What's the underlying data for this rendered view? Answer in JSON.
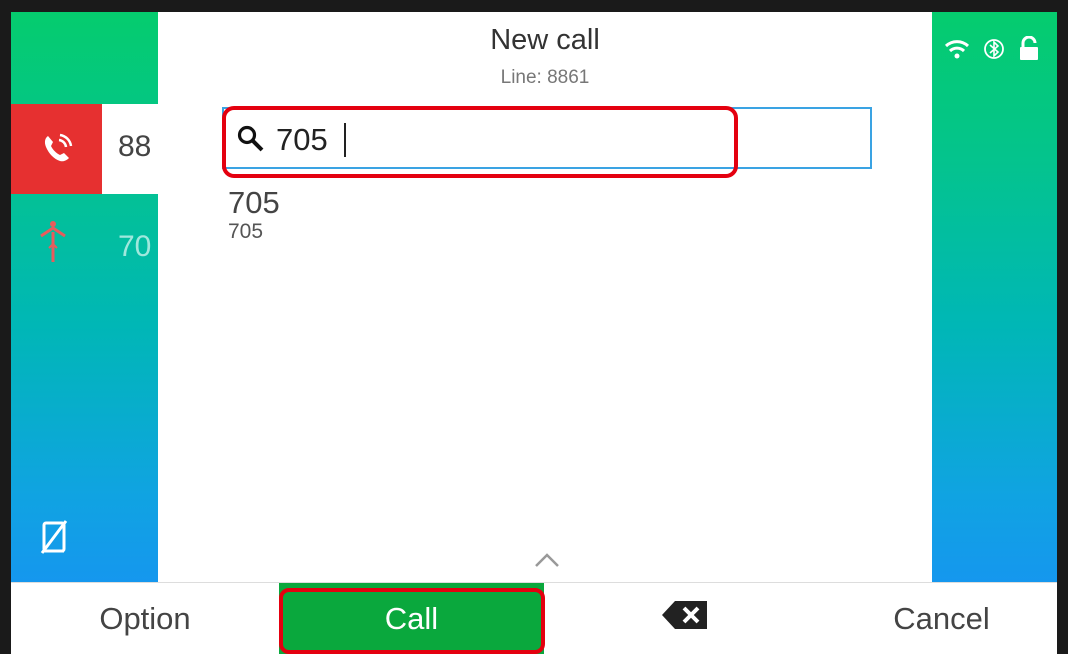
{
  "header": {
    "title": "New call",
    "subtitle": "Line: 8861"
  },
  "lines": [
    {
      "label": "88",
      "state": "active",
      "icon": "phone-ringing-icon",
      "icon_bg": "#e63030"
    },
    {
      "label": "70",
      "state": "inactive",
      "icon": "call-transfer-icon"
    }
  ],
  "sidebar_bottom_icon": "phone-muted-icon",
  "status_icons": [
    "wifi-icon",
    "bluetooth-icon",
    "unlocked-icon"
  ],
  "search": {
    "value": "705",
    "icon": "search-icon",
    "border_color": "#3aa3e3"
  },
  "results": [
    {
      "name": "705",
      "number": "705"
    }
  ],
  "softkeys": {
    "option": "Option",
    "call": "Call",
    "backspace_icon": "backspace-icon",
    "cancel": "Cancel"
  },
  "colors": {
    "panel_gradient_top": "#05cc6e",
    "panel_gradient_bottom": "#1597ee",
    "call_green": "#0aa83d",
    "highlight_red": "#e4000f",
    "active_line_red": "#e63030"
  }
}
